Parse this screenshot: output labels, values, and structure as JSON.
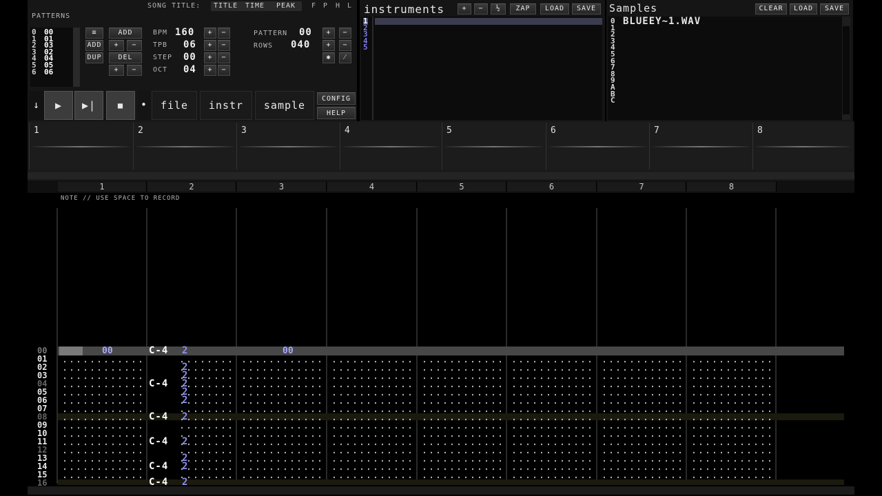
{
  "top": {
    "patterns_label": "PATTERNS",
    "song_title_label": "SONG TITLE:",
    "menu": [
      "TITLE",
      "TIME",
      "PEAK"
    ],
    "flags": [
      "F",
      "P",
      "H",
      "L"
    ]
  },
  "patterns": {
    "index": [
      "0",
      "1",
      "2",
      "3",
      "4",
      "5",
      "6"
    ],
    "values": [
      "00",
      "01",
      "03",
      "02",
      "04",
      "05",
      "06"
    ],
    "buttons": {
      "menu": "≡",
      "add_top": "ADD",
      "add": "ADD",
      "plus": "+",
      "minus": "−",
      "dup": "DUP",
      "del": "DEL"
    }
  },
  "controls": {
    "bpm_label": "BPM",
    "bpm": "160",
    "tpb_label": "TPB",
    "tpb": "06",
    "step_label": "STEP",
    "step": "00",
    "oct_label": "OCT",
    "oct": "04",
    "pattern_label": "PATTERN",
    "pattern": "00",
    "rows_label": "ROWS",
    "rows": "040",
    "star": "✱",
    "slash": "⁄"
  },
  "transport": {
    "down": "↓",
    "play": "▶",
    "play_pattern": "▶|",
    "stop": "■",
    "dot": "•",
    "file": "file",
    "instr": "instr",
    "sample": "sample",
    "config": "CONFIG",
    "help": "HELP"
  },
  "instruments": {
    "title": "instruments",
    "buttons": [
      "+",
      "−",
      "½",
      "ZAP",
      "LOAD",
      "SAVE"
    ],
    "indexes": [
      "1",
      "2",
      "3",
      "4",
      "5"
    ]
  },
  "samples": {
    "title": "Samples",
    "buttons": [
      "CLEAR",
      "LOAD",
      "SAVE"
    ],
    "indexes": [
      "0",
      "1",
      "2",
      "3",
      "4",
      "5",
      "6",
      "7",
      "8",
      "9",
      "A",
      "B",
      "C"
    ],
    "first_name": "BLUEEY~1.WAV"
  },
  "tracks": [
    "1",
    "2",
    "3",
    "4",
    "5",
    "6",
    "7",
    "8"
  ],
  "pattern_view": {
    "hint": "NOTE // USE SPACE TO RECORD",
    "columns": [
      "1",
      "2",
      "3",
      "4",
      "5",
      "6",
      "7",
      "8"
    ],
    "row_numbers": [
      "00",
      "01",
      "02",
      "03",
      "04",
      "05",
      "06",
      "07",
      "08",
      "09",
      "10",
      "11",
      "12",
      "13",
      "14",
      "15",
      "16"
    ],
    "row0_vol_1": "00",
    "row0_vol_3": "00",
    "notes": [
      {
        "row": 0,
        "note": "C-4",
        "inst": "2"
      },
      {
        "row": 1,
        "note": "",
        "inst": "2"
      },
      {
        "row": 2,
        "note": "",
        "inst": "2"
      },
      {
        "row": 3,
        "note": "C-4",
        "inst": "2"
      },
      {
        "row": 4,
        "note": "",
        "inst": "2"
      },
      {
        "row": 5,
        "note": "",
        "inst": "2"
      },
      {
        "row": 8,
        "note": "C-4",
        "inst": "2"
      },
      {
        "row": 11,
        "note": "C-4",
        "inst": "2"
      },
      {
        "row": 13,
        "note": "",
        "inst": "2"
      },
      {
        "row": 14,
        "note": "C-4",
        "inst": "2"
      },
      {
        "row": 16,
        "note": "C-4",
        "inst": "2"
      }
    ]
  }
}
